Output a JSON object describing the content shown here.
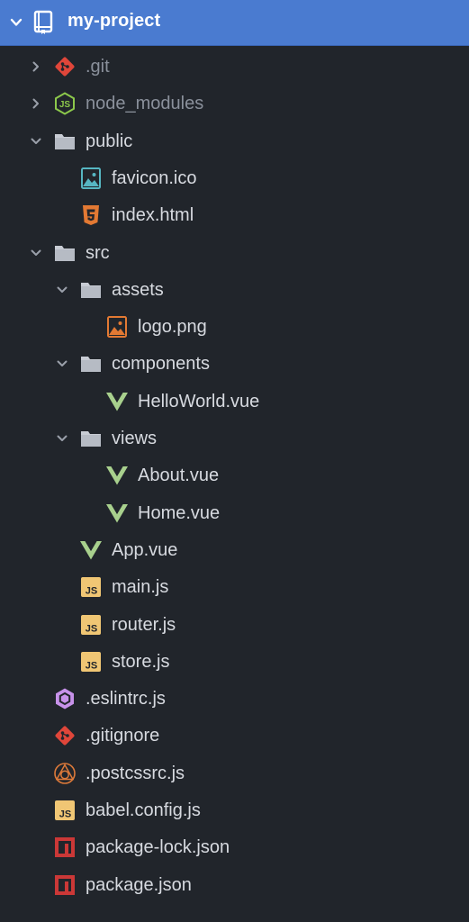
{
  "project": {
    "name": "my-project"
  },
  "colors": {
    "header_bg": "#4a7bd0",
    "panel_bg": "#21252b",
    "text": "#d7dae0",
    "dim_text": "#8a909b",
    "folder": "#c8ccd4",
    "git": "#e0463a",
    "node": "#8cc84b",
    "html5": "#e37933",
    "vue": "#a8d08d",
    "js": "#f0c674",
    "eslint": "#c792ea",
    "npm": "#cb3837"
  },
  "tree": [
    {
      "label": ".git",
      "icon": "git-icon",
      "kind": "folder",
      "state": "collapsed",
      "depth": 0,
      "dim": true
    },
    {
      "label": "node_modules",
      "icon": "nodejs-icon",
      "kind": "folder",
      "state": "collapsed",
      "depth": 0,
      "dim": true
    },
    {
      "label": "public",
      "icon": "folder-icon",
      "kind": "folder",
      "state": "expanded",
      "depth": 0
    },
    {
      "label": "favicon.ico",
      "icon": "image-icon",
      "kind": "file",
      "depth": 1
    },
    {
      "label": "index.html",
      "icon": "html5-icon",
      "kind": "file",
      "depth": 1
    },
    {
      "label": "src",
      "icon": "folder-icon",
      "kind": "folder",
      "state": "expanded",
      "depth": 0
    },
    {
      "label": "assets",
      "icon": "folder-icon",
      "kind": "folder",
      "state": "expanded",
      "depth": 1
    },
    {
      "label": "logo.png",
      "icon": "image-icon",
      "kind": "file",
      "depth": 2
    },
    {
      "label": "components",
      "icon": "folder-icon",
      "kind": "folder",
      "state": "expanded",
      "depth": 1
    },
    {
      "label": "HelloWorld.vue",
      "icon": "vue-icon",
      "kind": "file",
      "depth": 2
    },
    {
      "label": "views",
      "icon": "folder-icon",
      "kind": "folder",
      "state": "expanded",
      "depth": 1
    },
    {
      "label": "About.vue",
      "icon": "vue-icon",
      "kind": "file",
      "depth": 2
    },
    {
      "label": "Home.vue",
      "icon": "vue-icon",
      "kind": "file",
      "depth": 2
    },
    {
      "label": "App.vue",
      "icon": "vue-icon",
      "kind": "file",
      "depth": 1
    },
    {
      "label": "main.js",
      "icon": "js-icon",
      "kind": "file",
      "depth": 1
    },
    {
      "label": "router.js",
      "icon": "js-icon",
      "kind": "file",
      "depth": 1
    },
    {
      "label": "store.js",
      "icon": "js-icon",
      "kind": "file",
      "depth": 1
    },
    {
      "label": ".eslintrc.js",
      "icon": "eslint-icon",
      "kind": "file",
      "depth": 0
    },
    {
      "label": ".gitignore",
      "icon": "git-icon",
      "kind": "file",
      "depth": 0
    },
    {
      "label": ".postcssrc.js",
      "icon": "postcss-icon",
      "kind": "file",
      "depth": 0
    },
    {
      "label": "babel.config.js",
      "icon": "js-icon",
      "kind": "file",
      "depth": 0
    },
    {
      "label": "package-lock.json",
      "icon": "npm-icon",
      "kind": "file",
      "depth": 0
    },
    {
      "label": "package.json",
      "icon": "npm-icon",
      "kind": "file",
      "depth": 0
    }
  ]
}
